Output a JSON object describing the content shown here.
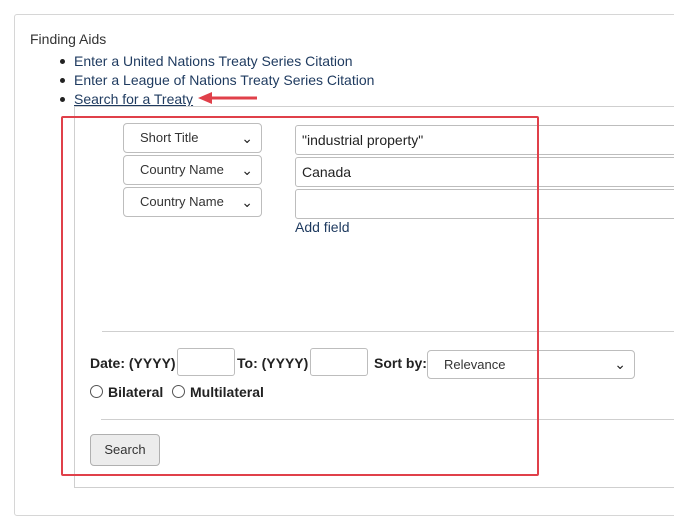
{
  "finding_aids": {
    "heading": "Finding Aids",
    "links": [
      "Enter a United Nations Treaty Series Citation",
      "Enter a League of Nations Treaty Series Citation",
      "Search for a Treaty"
    ]
  },
  "search_form": {
    "rows": [
      {
        "field": "Short Title",
        "value": "\"industrial property\""
      },
      {
        "field": "Country Name",
        "value": "Canada"
      },
      {
        "field": "Country Name",
        "value": ""
      }
    ],
    "add_field_label": "Add field",
    "date_label": "Date: (YYYY)",
    "to_label": "To: (YYYY)",
    "sort_label": "Sort by:",
    "sort_value": "Relevance",
    "radio_bilateral": "Bilateral",
    "radio_multilateral": "Multilateral",
    "search_button": "Search"
  },
  "colors": {
    "highlight": "#e0404a",
    "link": "#1e3a5f"
  }
}
